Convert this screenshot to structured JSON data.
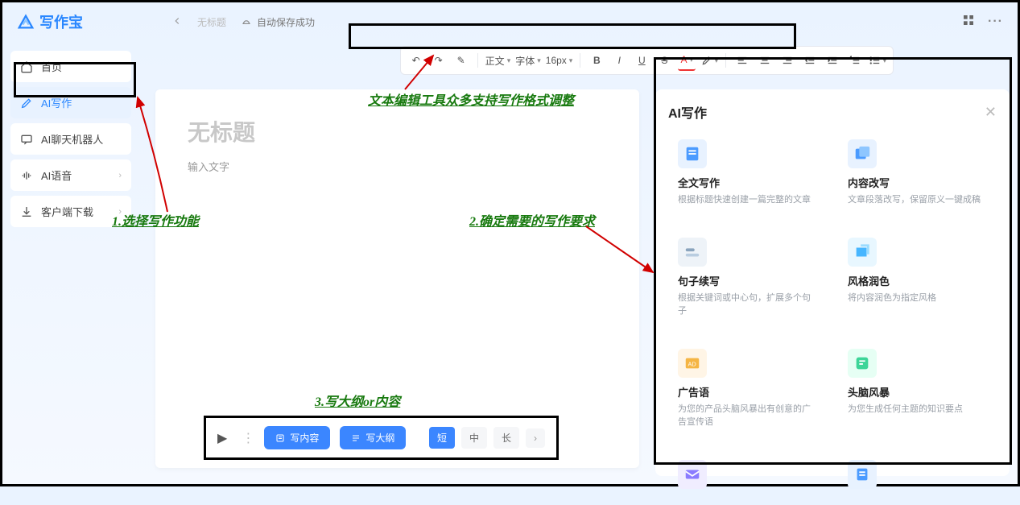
{
  "app": {
    "name": "写作宝"
  },
  "topbar": {
    "untitled": "无标题",
    "autosave": "自动保存成功"
  },
  "sidebar": {
    "items": [
      {
        "label": "首页"
      },
      {
        "label": "AI写作"
      },
      {
        "label": "AI聊天机器人"
      },
      {
        "label": "AI语音"
      },
      {
        "label": "客户端下载"
      }
    ]
  },
  "toolbar": {
    "undo": "↶",
    "redo": "↷",
    "format": "✎",
    "textmode": "正文",
    "font": "字体",
    "size": "16px",
    "bold": "B",
    "italic": "I",
    "underline": "U",
    "strike": "S",
    "color": "A",
    "highlight": "✎"
  },
  "editor": {
    "title_placeholder": "无标题",
    "body_placeholder": "输入文字"
  },
  "bottom": {
    "write_content": "写内容",
    "write_outline": "写大纲",
    "len_short": "短",
    "len_mid": "中",
    "len_long": "长"
  },
  "ai_panel": {
    "title": "AI写作",
    "cards": [
      {
        "title": "全文写作",
        "desc": "根据标题快速创建一篇完整的文章"
      },
      {
        "title": "内容改写",
        "desc": "文章段落改写，保留原义一键成稿"
      },
      {
        "title": "句子续写",
        "desc": "根据关键词或中心句，扩展多个句子"
      },
      {
        "title": "风格润色",
        "desc": "将内容润色为指定风格"
      },
      {
        "title": "广告语",
        "desc": "为您的产品头脑风暴出有创意的广告宣传语"
      },
      {
        "title": "头脑风暴",
        "desc": "为您生成任何主题的知识要点"
      }
    ]
  },
  "annotations": {
    "a1": "1.选择写作功能",
    "a2": "2.确定需要的写作要求",
    "a3": "3.写大纲or内容",
    "a_toolbar": "文本编辑工具众多支持写作格式调整"
  }
}
